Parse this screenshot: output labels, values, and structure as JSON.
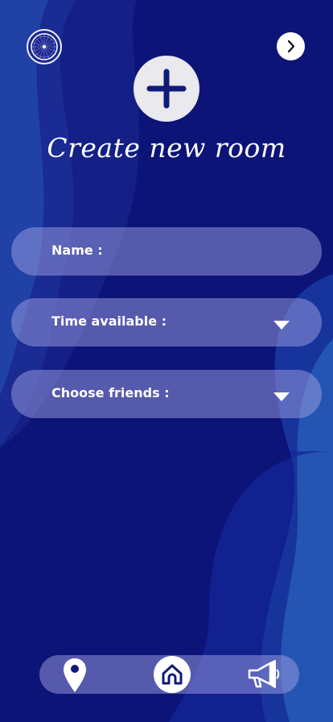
{
  "colors": {
    "background": "#0d1478",
    "field_fill": "rgba(160,160,225,0.5)",
    "icon_accent": "#101a78",
    "text": "#ffffff"
  },
  "header": {
    "logo_icon": "bicycle-wheel-icon",
    "next_icon": "chevron-right-icon",
    "add_icon": "plus-icon",
    "title": "Create new room"
  },
  "form": {
    "name_label": "Name :",
    "time_label": "Time available :",
    "friends_label": "Choose friends :",
    "dropdown_icon": "caret-down-icon"
  },
  "bottom_nav": {
    "items": [
      {
        "icon": "map-pin-icon"
      },
      {
        "icon": "home-icon"
      },
      {
        "icon": "megaphone-icon"
      }
    ]
  }
}
